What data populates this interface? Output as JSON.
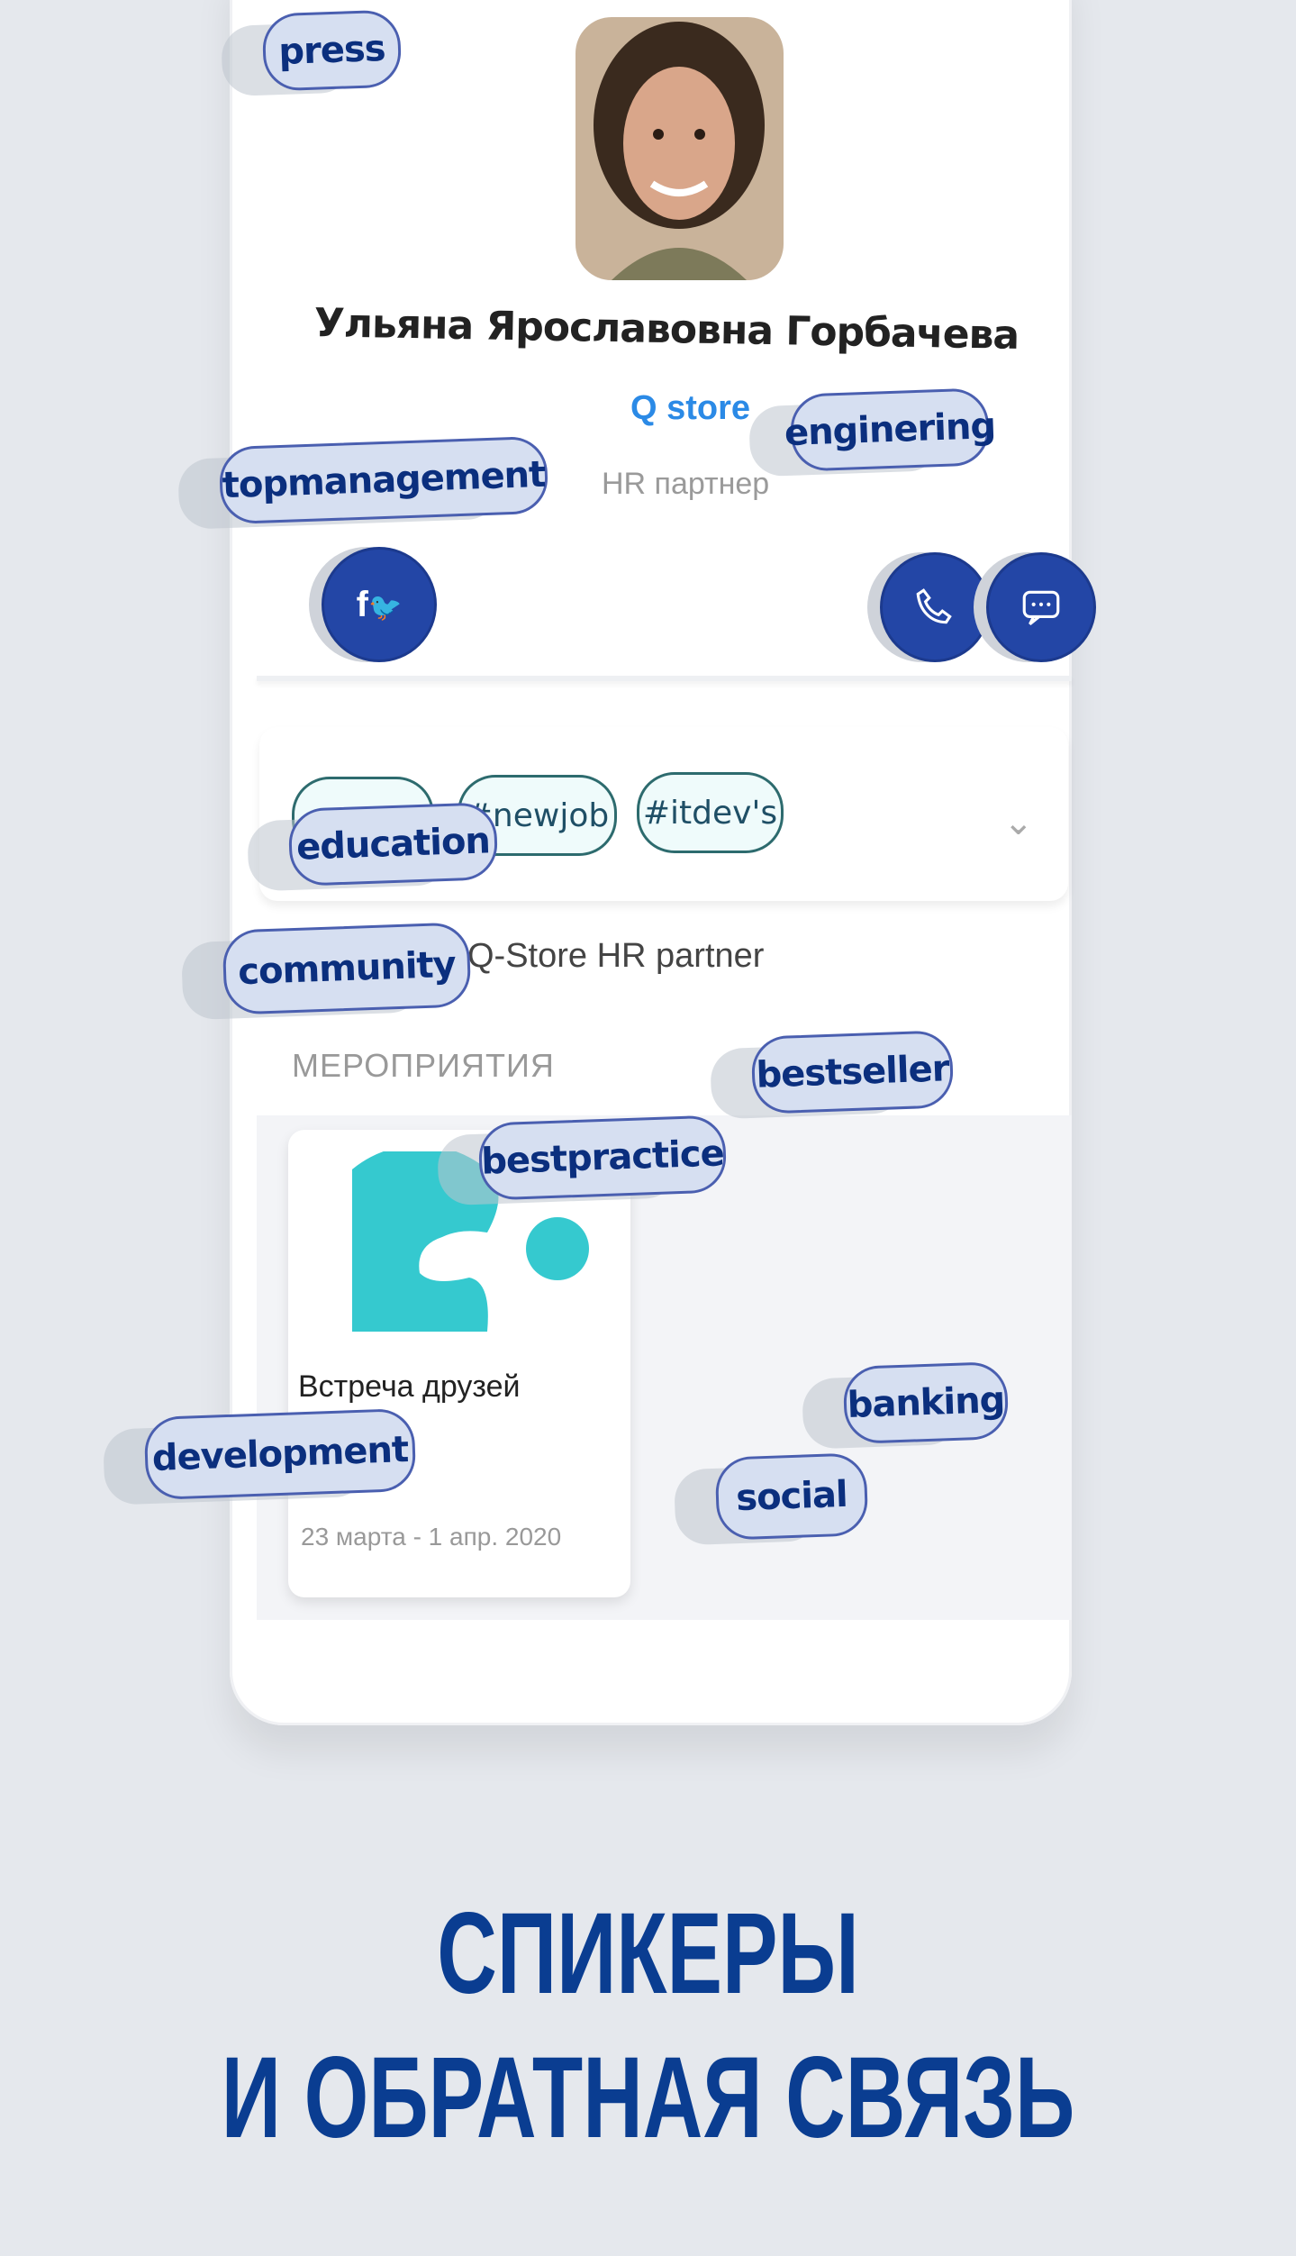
{
  "profile": {
    "name": "Ульяна Ярославовна Горбачева",
    "company": "Q store",
    "role": "HR партнер"
  },
  "actions": {
    "social_icon": "social-networks-icon",
    "phone_icon": "phone-icon",
    "chat_icon": "chat-icon"
  },
  "hashtags": [
    "",
    "#newjob",
    "#itdev's"
  ],
  "description": "Q-Store HR partner",
  "events_section": {
    "title": "МЕРОПРИЯТИЯ",
    "event": {
      "title": "Встреча друзей",
      "dates": "23 марта - 1 апр. 2020"
    }
  },
  "floating_tags": [
    "press",
    "topmanagement",
    "enginering",
    "education",
    "community",
    "bestseller",
    "bestpractice",
    "banking",
    "development",
    "social"
  ],
  "headline": {
    "line1": "СПИКЕРЫ",
    "line2": "И ОБРАТНАЯ СВЯЗЬ"
  },
  "colors": {
    "accent": "#2346a6",
    "headline": "#0a3d91",
    "link": "#2b8ae6",
    "logo": "#35c9cf"
  }
}
